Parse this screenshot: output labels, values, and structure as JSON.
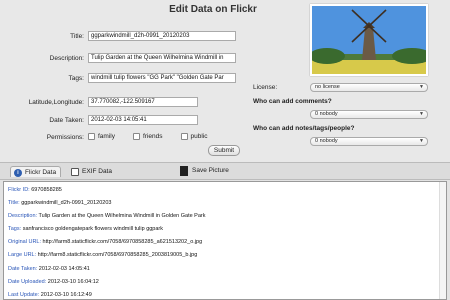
{
  "app_title": "Edit Data on Flickr",
  "form": {
    "title_label": "Title:",
    "title_value": "ggparkwindmill_d2h-0991_20120203",
    "description_label": "Description:",
    "description_value": "Tulip Garden at the Queen Wilhelmina Windmill in",
    "tags_label": "Tags:",
    "tags_value": "windmill tulip flowers \"GG Park\" \"Golden Gate Par",
    "latlong_label": "Latitude,Longitude:",
    "latlong_value": "37.770082,-122.509167",
    "date_label": "Date Taken:",
    "date_value": "2012-02-03 14:05:41",
    "permissions_label": "Permissions:",
    "permissions": [
      "family",
      "friends",
      "public"
    ],
    "submit_label": "Submit"
  },
  "right": {
    "license_label": "License:",
    "license_value": "no license",
    "comments_label": "Who can add comments?",
    "comments_value": "0 nobody",
    "notes_label": "Who can add notes/tags/people?",
    "notes_value": "0 nobody"
  },
  "tabs": {
    "flickr": "Flickr Data",
    "exif": "EXIF Data",
    "save": "Save Picture"
  },
  "details": [
    {
      "key": "Flickr ID:",
      "value": "6970858285"
    },
    {
      "key": "Title:",
      "value": "ggparkwindmill_d2h-0991_20120203"
    },
    {
      "key": "Description:",
      "value": "Tulip Garden at the Queen Wilhelmina Windmill in Golden Gate Park"
    },
    {
      "key": "Tags:",
      "value": "sanfrancisco goldengatepark flowers windmill tulip ggpark"
    },
    {
      "key": "Original URL:",
      "value": "http://farm8.staticflickr.com/7058/6970858285_a621513202_o.jpg"
    },
    {
      "key": "Large URL:",
      "value": "http://farm8.staticflickr.com/7058/6970858285_2003819005_b.jpg"
    },
    {
      "key": "Date Taken:",
      "value": "2012-02-03 14:05:41"
    },
    {
      "key": "Date Uploaded:",
      "value": "2012-03-10 16:04:12"
    },
    {
      "key": "Last Update:",
      "value": "2012-03-10 16:12:49"
    }
  ]
}
